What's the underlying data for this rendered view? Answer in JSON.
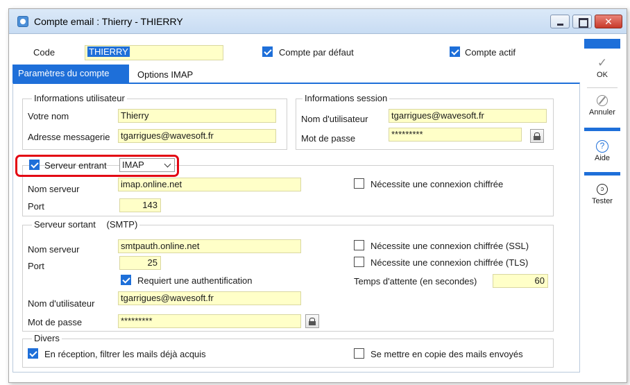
{
  "window": {
    "title": "Compte email : Thierry - THIERRY",
    "close_glyph": "✕"
  },
  "header": {
    "code_label": "Code",
    "code_value": "THIERRY",
    "default_account_label": "Compte par défaut",
    "default_account_checked": true,
    "active_account_label": "Compte actif",
    "active_account_checked": true
  },
  "tabs": [
    {
      "label": "Paramètres du compte",
      "active": true
    },
    {
      "label": "Options IMAP",
      "active": false
    }
  ],
  "user_info": {
    "title": "Informations utilisateur",
    "name_label": "Votre nom",
    "name_value": "Thierry",
    "email_label": "Adresse messagerie",
    "email_value": "tgarrigues@wavesoft.fr"
  },
  "session_info": {
    "title": "Informations session",
    "username_label": "Nom d'utilisateur",
    "username_value": "tgarrigues@wavesoft.fr",
    "password_label": "Mot de passe",
    "password_value": "*********"
  },
  "incoming": {
    "enabled": true,
    "label": "Serveur entrant",
    "protocol": "IMAP",
    "server_label": "Nom serveur",
    "server_value": "imap.online.net",
    "port_label": "Port",
    "port_value": "143",
    "encrypted_label": "Nécessite une connexion chiffrée",
    "encrypted_checked": false
  },
  "outgoing": {
    "title": "Serveur sortant",
    "protocol_note": "(SMTP)",
    "server_label": "Nom serveur",
    "server_value": "smtpauth.online.net",
    "port_label": "Port",
    "port_value": "25",
    "ssl_label": "Nécessite une connexion chiffrée (SSL)",
    "ssl_checked": false,
    "tls_label": "Nécessite une connexion chiffrée (TLS)",
    "tls_checked": false,
    "auth_label": "Requiert une authentification",
    "auth_checked": true,
    "timeout_label": "Temps d'attente (en secondes)",
    "timeout_value": "60",
    "username_label": "Nom d'utilisateur",
    "username_value": "tgarrigues@wavesoft.fr",
    "password_label": "Mot de passe",
    "password_value": "*********"
  },
  "misc": {
    "title": "Divers",
    "filter_label": "En réception, filtrer les mails déjà acquis",
    "filter_checked": true,
    "copy_label": "Se mettre en copie des mails envoyés",
    "copy_checked": false
  },
  "side_buttons": {
    "ok": "OK",
    "cancel": "Annuler",
    "help": "Aide",
    "help_glyph": "?",
    "test": "Tester",
    "test_glyph": "ↄ"
  },
  "colors": {
    "accent": "#1e6fd9",
    "field_bg": "#ffffc8",
    "highlight": "#e30613"
  },
  "icons": [
    "app-icon",
    "minimize-icon",
    "maximize-icon",
    "close-icon",
    "check-icon",
    "cancel-icon",
    "help-icon",
    "test-icon",
    "lock-icon",
    "chevron-down-icon"
  ]
}
